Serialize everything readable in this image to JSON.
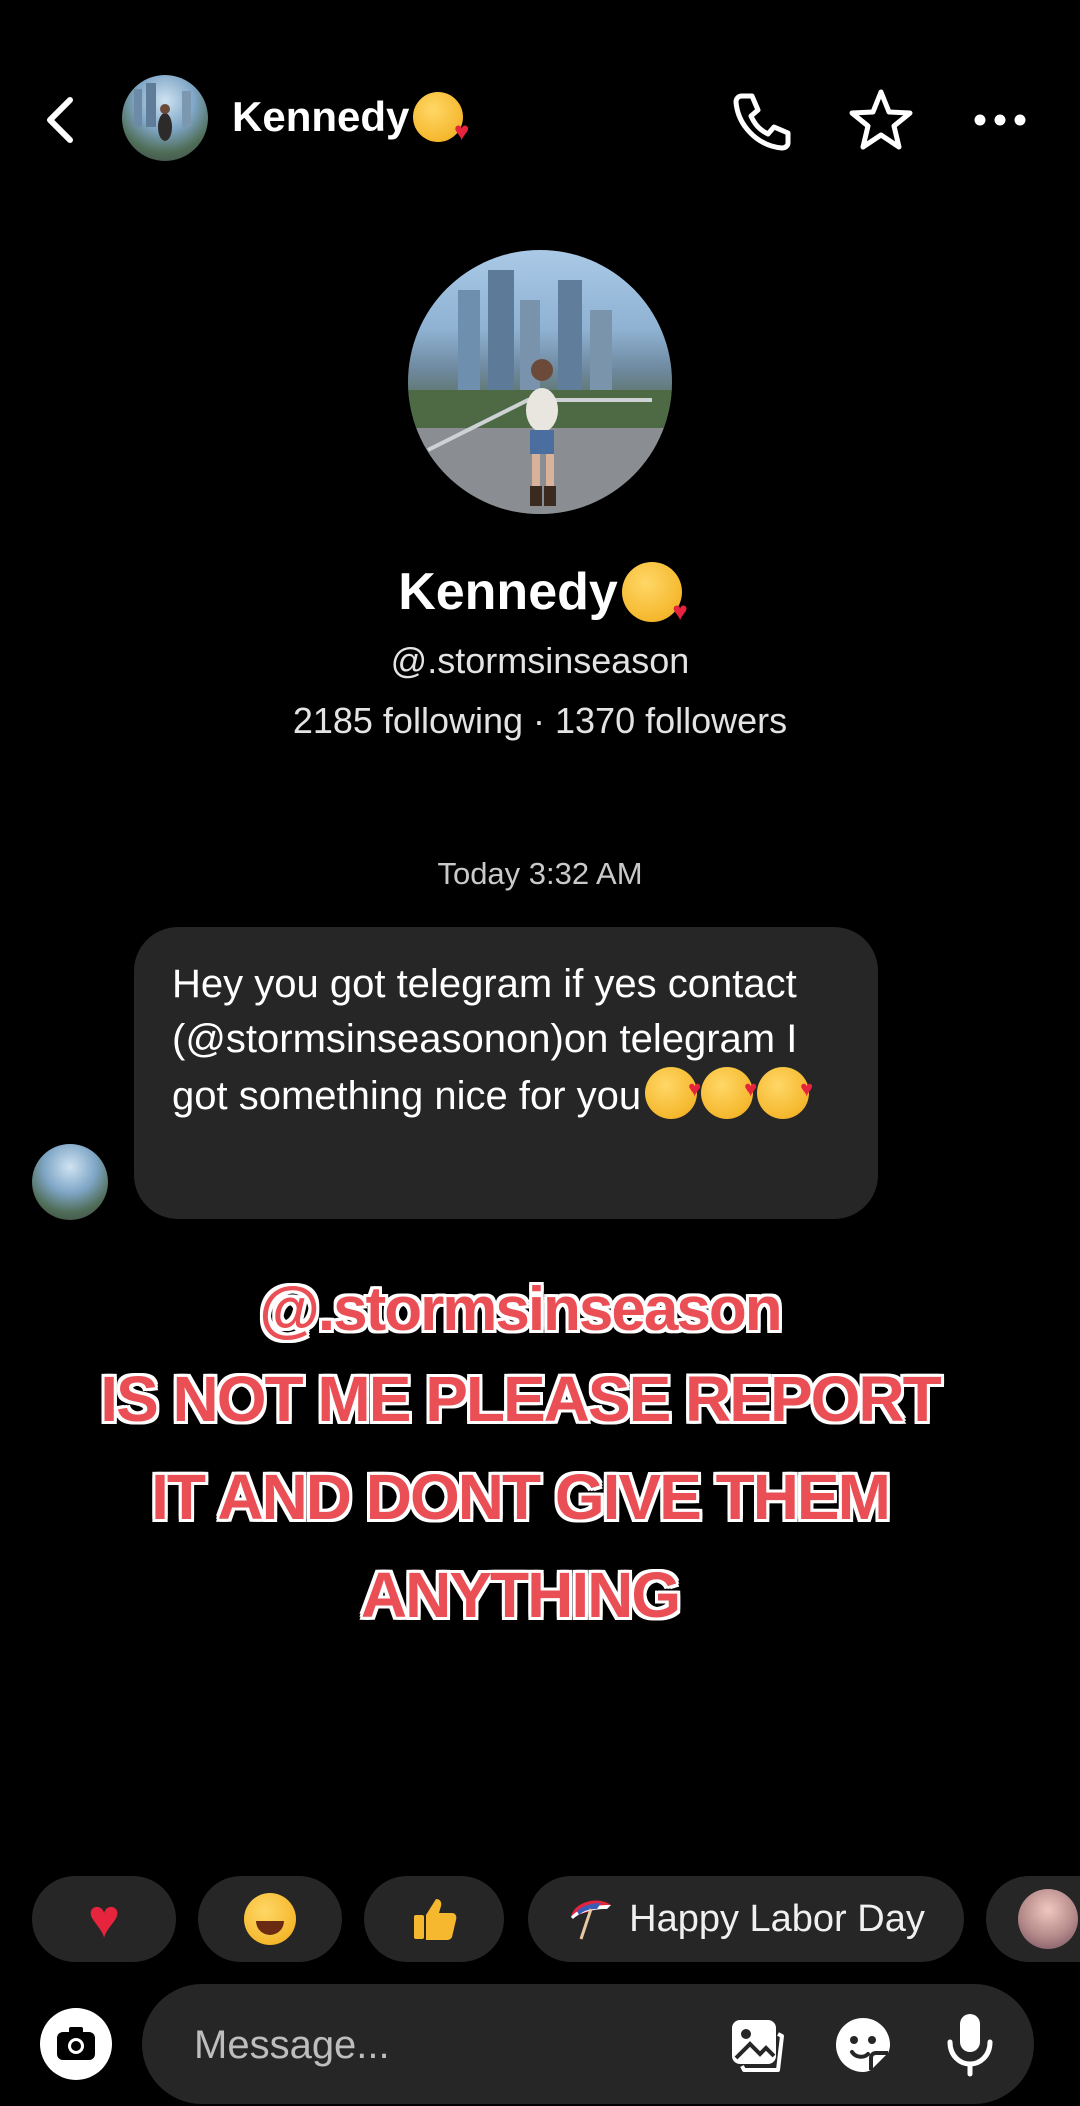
{
  "header": {
    "contact_name": "Kennedy",
    "name_emoji": "face-blowing-a-kiss"
  },
  "profile": {
    "name": "Kennedy",
    "handle": "@.stormsinseason",
    "stats": "2185 following · 1370 followers"
  },
  "conversation": {
    "timestamp": "Today 3:32 AM",
    "message": {
      "text": "Hey you got telegram if yes contact (@stormsinseasonon)on telegram I got something nice for you",
      "emojis": [
        "smiling-face-with-hearts",
        "smiling-face-with-hearts",
        "smiling-face-with-hearts"
      ]
    }
  },
  "overlay": {
    "line1": "@.stormsinseason",
    "line2": "IS NOT ME PLEASE REPORT",
    "line3": "IT AND DONT GIVE THEM",
    "line4": "ANYTHING",
    "color": "#ea4f55"
  },
  "quick_replies": {
    "heart": "heart-emoji",
    "laugh": "tears-of-joy-emoji",
    "thumb": "thumbs-up-emoji",
    "labor_day": "Happy Labor Day",
    "sticker": "sticker-thumbnail"
  },
  "composer": {
    "placeholder": "Message..."
  },
  "colors": {
    "background": "#000000",
    "bubble": "#262626",
    "accent_red": "#ea4f55"
  }
}
